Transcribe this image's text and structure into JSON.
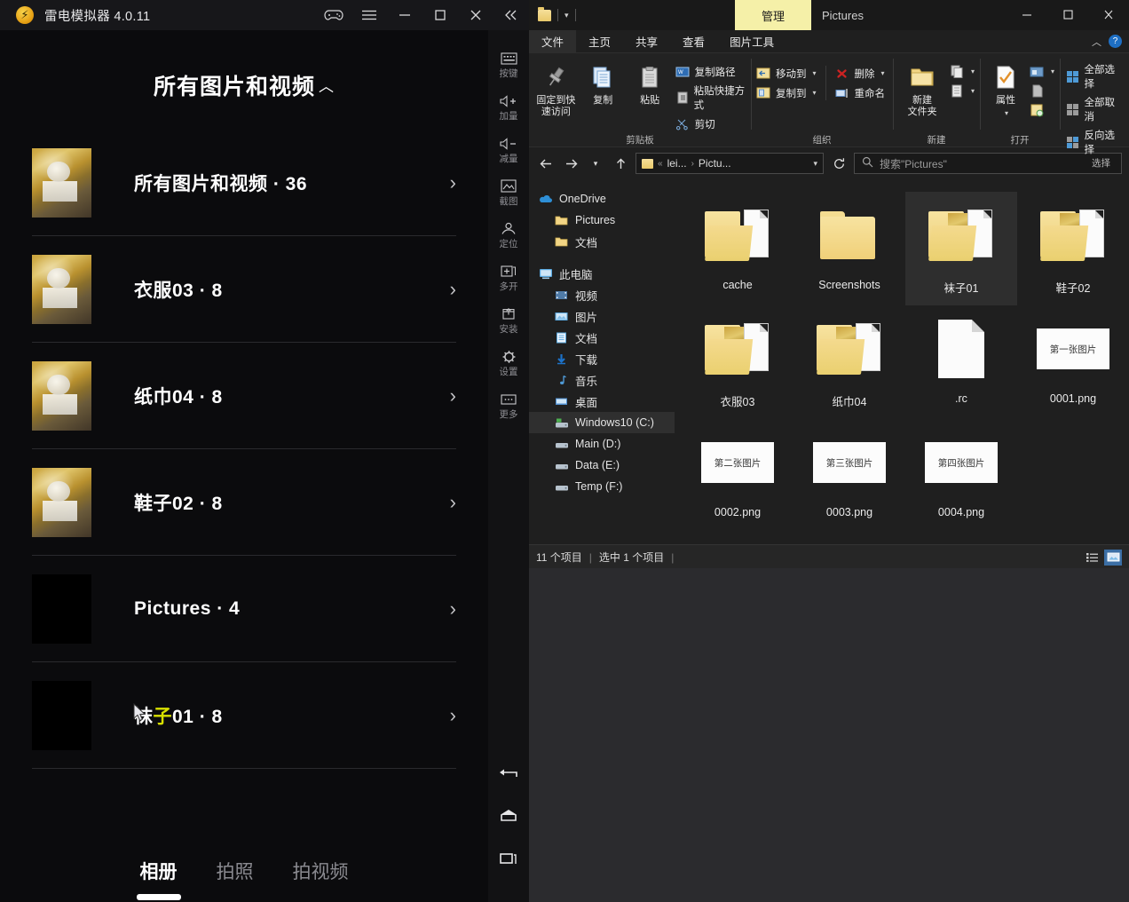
{
  "emulator": {
    "app_title": "雷电模拟器 4.0.11",
    "logo_glyph": "⚡",
    "window_buttons": [
      "gamepad-icon",
      "menu-icon",
      "minimize-icon",
      "maximize-icon",
      "close-icon",
      "collapse-icon"
    ],
    "album_header": "所有图片和视频",
    "album_header_caret": "︿",
    "albums": [
      {
        "name": "所有图片和视频",
        "count": "36",
        "label": "所有图片和视频 · 36",
        "thumb": "photo"
      },
      {
        "name": "衣服03",
        "count": "8",
        "label": "衣服03 · 8",
        "thumb": "photo"
      },
      {
        "name": "纸巾04",
        "count": "8",
        "label": "纸巾04 · 8",
        "thumb": "photo"
      },
      {
        "name": "鞋子02",
        "count": "8",
        "label": "鞋子02 · 8",
        "thumb": "photo"
      },
      {
        "name": "Pictures",
        "count": "4",
        "label": "Pictures · 4",
        "thumb": "black"
      },
      {
        "name": "袜子01",
        "count": "8",
        "label": "袜子01 · 8",
        "thumb": "black",
        "highlight_char": "子"
      }
    ],
    "chevron": "›",
    "tabs": [
      {
        "label": "相册",
        "active": true
      },
      {
        "label": "拍照",
        "active": false
      },
      {
        "label": "拍视频",
        "active": false
      }
    ],
    "rail": [
      {
        "label": "按键",
        "icon": "keyboard-icon"
      },
      {
        "label": "加量",
        "icon": "volume-up-icon"
      },
      {
        "label": "减量",
        "icon": "volume-down-icon"
      },
      {
        "label": "截图",
        "icon": "screenshot-icon"
      },
      {
        "label": "定位",
        "icon": "location-icon"
      },
      {
        "label": "多开",
        "icon": "multi-instance-icon"
      },
      {
        "label": "安装",
        "icon": "install-apk-icon"
      },
      {
        "label": "设置",
        "icon": "gear-icon"
      },
      {
        "label": "更多",
        "icon": "more-icon"
      }
    ],
    "nav_buttons": [
      "back-icon",
      "home-icon",
      "recents-icon"
    ]
  },
  "explorer": {
    "window_title": "Pictures",
    "contextual_tab": "管理",
    "ribbon_tabs": [
      {
        "label": "文件",
        "active": true
      },
      {
        "label": "主页",
        "active": false
      },
      {
        "label": "共享",
        "active": false
      },
      {
        "label": "查看",
        "active": false
      },
      {
        "label": "图片工具",
        "active": false
      }
    ],
    "help_glyph": "?",
    "collapse_glyph": "︿",
    "ribbon": {
      "groups": [
        {
          "label": "剪贴板",
          "big": [
            {
              "label": "固定到快\n速访问",
              "line1": "固定到快",
              "line2": "速访问",
              "icon": "pin-icon"
            },
            {
              "label": "复制",
              "line1": "复制",
              "line2": "",
              "icon": "copy-icon"
            },
            {
              "label": "粘贴",
              "line1": "粘贴",
              "line2": "",
              "icon": "paste-icon"
            }
          ],
          "small": [
            {
              "label": "复制路径",
              "icon": "copy-path-icon"
            },
            {
              "label": "粘贴快捷方式",
              "icon": "paste-shortcut-icon"
            },
            {
              "label": "剪切",
              "icon": "scissors-icon"
            }
          ]
        },
        {
          "label": "组织",
          "small": [
            {
              "label": "移动到",
              "icon": "move-to-icon",
              "dropdown": true
            },
            {
              "label": "复制到",
              "icon": "copy-to-icon",
              "dropdown": true
            },
            {
              "label": "删除",
              "icon": "delete-icon",
              "dropdown": true
            },
            {
              "label": "重命名",
              "icon": "rename-icon",
              "dropdown": false
            }
          ]
        },
        {
          "label": "新建",
          "big": [
            {
              "line1": "新建",
              "line2": "文件夹",
              "icon": "new-folder-icon"
            }
          ],
          "small": [
            {
              "label": "",
              "icon": "new-item-icon",
              "dropdown": true
            },
            {
              "label": "",
              "icon": "easy-access-icon",
              "dropdown": true
            }
          ]
        },
        {
          "label": "打开",
          "big": [
            {
              "line1": "属性",
              "line2": "",
              "icon": "properties-icon",
              "dropdown": true
            }
          ],
          "small": [
            {
              "label": "",
              "icon": "open-icon",
              "dropdown": true
            },
            {
              "label": "",
              "icon": "edit-icon",
              "dropdown": false
            },
            {
              "label": "",
              "icon": "history-icon",
              "dropdown": false
            }
          ]
        },
        {
          "label": "选择",
          "small": [
            {
              "label": "全部选择",
              "icon": "select-all-icon"
            },
            {
              "label": "全部取消",
              "icon": "select-none-icon"
            },
            {
              "label": "反向选择",
              "icon": "invert-selection-icon"
            }
          ]
        }
      ]
    },
    "address": {
      "back": "back-arrow-icon",
      "forward": "forward-arrow-icon",
      "recent": "recent-dropdown-icon",
      "up": "up-arrow-icon",
      "crumb_prefix": "«",
      "crumbs": [
        "lei...",
        "Pictu..."
      ],
      "crumb_sep": "›",
      "dropdown": "chevron-down-icon",
      "refresh": "refresh-icon",
      "search_placeholder": "搜索\"Pictures\"",
      "search_icon": "search-icon"
    },
    "nav_pane": [
      {
        "label": "OneDrive",
        "icon": "onedrive-icon",
        "indent": 0,
        "selected": false
      },
      {
        "label": "Pictures",
        "icon": "folder-icon",
        "indent": 1,
        "selected": false
      },
      {
        "label": "文档",
        "icon": "folder-icon",
        "indent": 1,
        "selected": false
      },
      {
        "label": "此电脑",
        "icon": "this-pc-icon",
        "indent": 0,
        "selected": false,
        "gap_before": true
      },
      {
        "label": "视频",
        "icon": "videos-icon",
        "indent": 1,
        "selected": false
      },
      {
        "label": "图片",
        "icon": "pictures-icon",
        "indent": 1,
        "selected": false
      },
      {
        "label": "文档",
        "icon": "documents-icon",
        "indent": 1,
        "selected": false
      },
      {
        "label": "下载",
        "icon": "downloads-icon",
        "indent": 1,
        "selected": false
      },
      {
        "label": "音乐",
        "icon": "music-icon",
        "indent": 1,
        "selected": false
      },
      {
        "label": "桌面",
        "icon": "desktop-icon",
        "indent": 1,
        "selected": false
      },
      {
        "label": "Windows10 (C:)",
        "icon": "windows-drive-icon",
        "indent": 1,
        "selected": true
      },
      {
        "label": "Main (D:)",
        "icon": "drive-icon",
        "indent": 1,
        "selected": false
      },
      {
        "label": "Data (E:)",
        "icon": "drive-icon",
        "indent": 1,
        "selected": false
      },
      {
        "label": "Temp (F:)",
        "icon": "drive-icon",
        "indent": 1,
        "selected": false
      }
    ],
    "files": [
      {
        "name": "cache",
        "type": "folder-open",
        "selected": false
      },
      {
        "name": "Screenshots",
        "type": "folder-plain",
        "selected": false
      },
      {
        "name": "袜子01",
        "type": "folder-open-photo",
        "selected": true
      },
      {
        "name": "鞋子02",
        "type": "folder-open-photo",
        "selected": false
      },
      {
        "name": "衣服03",
        "type": "folder-open-photo",
        "selected": false
      },
      {
        "name": "纸巾04",
        "type": "folder-open-photo",
        "selected": false
      },
      {
        "name": ".rc",
        "type": "doc",
        "selected": false
      },
      {
        "name": "0001.png",
        "type": "png",
        "preview": "第一张图片",
        "selected": false
      },
      {
        "name": "0002.png",
        "type": "png",
        "preview": "第二张图片",
        "selected": false
      },
      {
        "name": "0003.png",
        "type": "png",
        "preview": "第三张图片",
        "selected": false
      },
      {
        "name": "0004.png",
        "type": "png",
        "preview": "第四张图片",
        "selected": false
      }
    ],
    "status": {
      "item_count": "11 个项目",
      "selection": "选中 1 个项目",
      "sep": "|",
      "view_details_icon": "details-view-icon",
      "view_large_icon": "large-icons-view-icon"
    }
  },
  "colors": {
    "contextual_tab_bg": "#f5f0a8",
    "highlight_char": "#d8e000",
    "folder_yellow": "#f0d079",
    "accent_blue": "#3b6ea5"
  }
}
